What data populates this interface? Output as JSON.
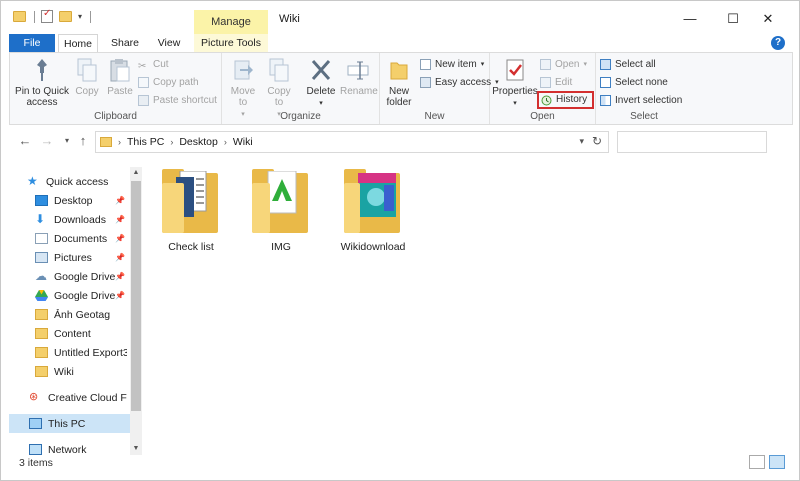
{
  "window": {
    "title": "Wiki",
    "manage_tab": "Manage"
  },
  "tabs": {
    "file": "File",
    "home": "Home",
    "share": "Share",
    "view": "View",
    "picture_tools": "Picture Tools",
    "help": "?"
  },
  "ribbon": {
    "clipboard": {
      "label": "Clipboard",
      "pin": "Pin to Quick access",
      "copy": "Copy",
      "paste": "Paste",
      "cut": "Cut",
      "copy_path": "Copy path",
      "paste_shortcut": "Paste shortcut"
    },
    "organize": {
      "label": "Organize",
      "move_to": "Move to",
      "copy_to": "Copy to",
      "delete": "Delete",
      "rename": "Rename"
    },
    "new": {
      "label": "New",
      "new_folder": "New folder",
      "new_item": "New item",
      "easy_access": "Easy access"
    },
    "open": {
      "label": "Open",
      "properties": "Properties",
      "open": "Open",
      "edit": "Edit",
      "history": "History"
    },
    "select": {
      "label": "Select",
      "select_all": "Select all",
      "select_none": "Select none",
      "invert": "Invert selection"
    }
  },
  "address": {
    "parts": [
      "This PC",
      "Desktop",
      "Wiki"
    ],
    "search_placeholder": ""
  },
  "nav": {
    "quick_access": "Quick access",
    "items": [
      {
        "label": "Desktop",
        "icon": "desktop-icon",
        "pinned": true
      },
      {
        "label": "Downloads",
        "icon": "download-icon",
        "pinned": true
      },
      {
        "label": "Documents",
        "icon": "documents-icon",
        "pinned": true
      },
      {
        "label": "Pictures",
        "icon": "pictures-icon",
        "pinned": true
      },
      {
        "label": "Google Drive",
        "icon": "cloud-icon",
        "pinned": true
      },
      {
        "label": "Google Drive",
        "icon": "google-drive-icon",
        "pinned": true
      },
      {
        "label": "Ảnh Geotag",
        "icon": "folder-icon",
        "pinned": false
      },
      {
        "label": "Content",
        "icon": "folder-icon",
        "pinned": false
      },
      {
        "label": "Untitled Export3",
        "icon": "folder-icon",
        "pinned": false
      },
      {
        "label": "Wiki",
        "icon": "folder-icon",
        "pinned": false
      }
    ],
    "creative_cloud": "Creative Cloud Fil",
    "this_pc": "This PC",
    "network": "Network"
  },
  "files": [
    {
      "name": "Check list"
    },
    {
      "name": "IMG"
    },
    {
      "name": "Wikidownload"
    }
  ],
  "status": {
    "count": "3 items"
  },
  "colors": {
    "accent": "#1e6fc9",
    "manage_tab": "#fbf3a8",
    "selection": "#cce4f7",
    "history_outline": "#d32f2f"
  }
}
